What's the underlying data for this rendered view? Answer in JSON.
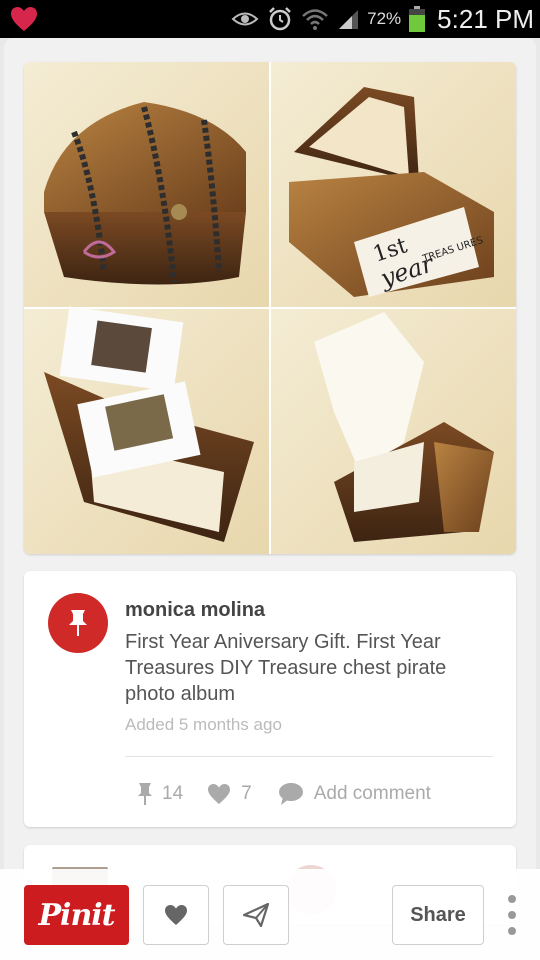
{
  "status_bar": {
    "battery_percent": "72%",
    "time": "5:21 PM",
    "icons": [
      "heart-app-icon",
      "eye-icon",
      "alarm-icon",
      "wifi-icon",
      "signal-icon",
      "battery-icon"
    ]
  },
  "pin": {
    "image_alt": "Treasure chest photo album collage",
    "photo_texts": {
      "card_line1": "1st",
      "card_line2": "year",
      "card_line3": "TREAS URES"
    },
    "user_name": "monica molina",
    "description": "First Year Aniversary Gift. First Year Treasures DIY Treasure chest pirate photo album",
    "added": "Added 5 months ago",
    "repin_count": "14",
    "like_count": "7",
    "add_comment": "Add comment"
  },
  "actions": {
    "pinit_label": "Pinit",
    "share_label": "Share",
    "icons": [
      "heart-icon",
      "send-icon",
      "more-icon"
    ]
  },
  "colors": {
    "brand_red": "#cc1c20",
    "avatar_red": "#cf2a27",
    "status_bar": "#000000",
    "background": "#e9e9e9",
    "battery_green": "#6fc93a"
  }
}
